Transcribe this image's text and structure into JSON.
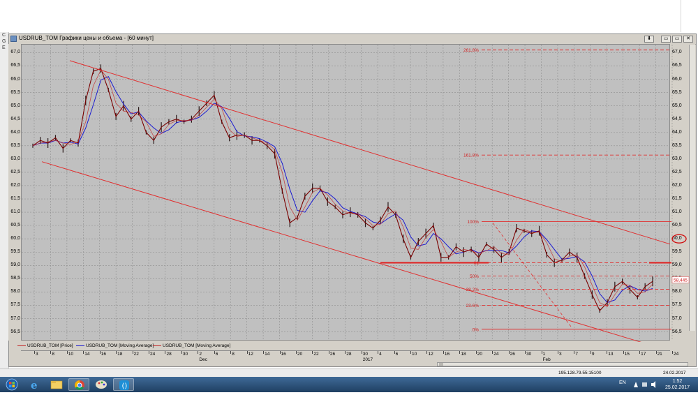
{
  "window": {
    "title": "USDRUB_TOM Графики цены и объема - [60 минут]",
    "buttons": {
      "download": "⬇",
      "minimize": "▭",
      "restore": "▭",
      "close": "✕"
    }
  },
  "left_panel_letters": [
    "C",
    "G",
    "E"
  ],
  "chart_data": {
    "type": "line",
    "ylim": [
      56.2,
      67.3
    ],
    "y_ticks": [
      "67,0",
      "66,5",
      "66,0",
      "65,5",
      "65,0",
      "64,5",
      "64,0",
      "63,5",
      "63,0",
      "62,5",
      "62,0",
      "61,5",
      "61,0",
      "60,5",
      "60,0",
      "59,5",
      "59,0",
      "58,5",
      "58,0",
      "57,5",
      "57,0",
      "56,5"
    ],
    "x_tick_labels": [
      "3",
      "8",
      "10",
      "14",
      "16",
      "18",
      "22",
      "24",
      "28",
      "30",
      "2",
      "6",
      "8",
      "12",
      "14",
      "16",
      "20",
      "22",
      "26",
      "28",
      "30",
      "4",
      "6",
      "10",
      "12",
      "16",
      "18",
      "20",
      "24",
      "26",
      "30",
      "1",
      "3",
      "7",
      "9",
      "13",
      "15",
      "17",
      "21",
      "24"
    ],
    "month_labels": [
      {
        "label": "Dec",
        "at": "30"
      },
      {
        "label": "2017",
        "at": "28"
      },
      {
        "label": "Feb",
        "at": "30"
      }
    ],
    "series": [
      {
        "name": "USDRUB_TOM [Price]",
        "color": "#7a0000",
        "values": [
          63.5,
          63.7,
          63.6,
          63.8,
          63.4,
          63.7,
          63.6,
          65.2,
          66.3,
          66.4,
          65.6,
          64.6,
          65.0,
          64.5,
          64.8,
          64.0,
          63.7,
          64.2,
          64.4,
          64.5,
          64.4,
          64.5,
          64.8,
          65.1,
          65.4,
          64.4,
          63.8,
          63.9,
          63.9,
          63.7,
          63.7,
          63.5,
          63.2,
          61.8,
          60.6,
          60.8,
          61.6,
          61.9,
          61.9,
          61.4,
          61.2,
          60.9,
          61.0,
          60.9,
          60.6,
          60.4,
          60.7,
          61.2,
          60.9,
          60.0,
          59.3,
          59.9,
          60.2,
          60.5,
          59.3,
          59.3,
          59.7,
          59.5,
          59.6,
          59.3,
          59.8,
          59.6,
          59.3,
          59.5,
          60.4,
          60.3,
          60.2,
          60.3,
          59.4,
          59.1,
          59.2,
          59.5,
          59.3,
          58.6,
          57.9,
          57.3,
          57.6,
          58.2,
          58.4,
          58.1,
          57.8,
          58.2,
          58.4
        ]
      },
      {
        "name": "USDRUB_TOM [Moving Average]",
        "color": "#1a1ad0"
      },
      {
        "name": "USDRUB_TOM [Moving Average]",
        "color": "#c22a2a"
      }
    ],
    "fibonacci": [
      {
        "label": "261.8%",
        "value": 67.1
      },
      {
        "label": "161.8%",
        "value": 63.15
      },
      {
        "label": "100%",
        "value": 60.65
      },
      {
        "label": "61",
        "value": 59.1
      },
      {
        "label": "50%",
        "value": 58.6
      },
      {
        "label": "38.2%",
        "value": 58.1
      },
      {
        "label": "23.6%",
        "value": 57.5
      },
      {
        "label": "0%",
        "value": 56.6
      }
    ],
    "markers": {
      "circled": "60,0",
      "last_price": "58,445"
    },
    "grid": true
  },
  "status": {
    "connection": "195.128.79.55:15100",
    "date": "24.02.2017"
  },
  "taskbar": {
    "language": "EN",
    "clock_time": "1:52",
    "clock_date": "25.02.2017"
  }
}
